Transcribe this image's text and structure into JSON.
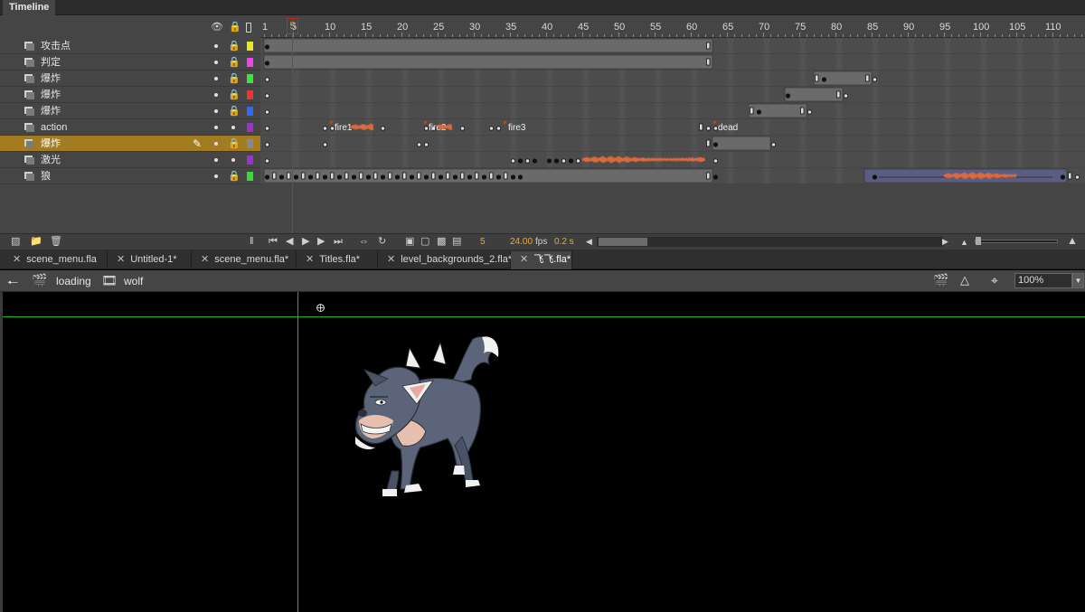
{
  "timeline": {
    "tab_label": "Timeline",
    "ruler_labels": [
      "1",
      "5",
      "10",
      "15",
      "20",
      "25",
      "30",
      "35",
      "40",
      "45",
      "50",
      "55",
      "60",
      "65",
      "70",
      "75",
      "80",
      "85",
      "90",
      "95",
      "100",
      "105",
      "110"
    ],
    "current_frame_badge": "5",
    "layers": [
      {
        "name": "攻击点",
        "color": "#e8e81c"
      },
      {
        "name": "判定",
        "color": "#ee44ee"
      },
      {
        "name": "爆炸",
        "color": "#44dd44"
      },
      {
        "name": "爆炸",
        "color": "#ee3333"
      },
      {
        "name": "爆炸",
        "color": "#3366ff"
      },
      {
        "name": "action",
        "color": "#9933cc"
      },
      {
        "name": "爆炸",
        "color": "#888888",
        "selected": true
      },
      {
        "name": "激光",
        "color": "#9933cc"
      },
      {
        "name": "狼",
        "color": "#33dd33"
      }
    ],
    "frame_labels": {
      "fire1": "fire1",
      "fire2": "fire2",
      "fire3": "fire3",
      "dead": "dead"
    },
    "footer": {
      "current_frame": "5",
      "fps": "24.00",
      "fps_unit": "fps",
      "elapsed_time": "0.2 s"
    }
  },
  "doc_tabs": [
    {
      "label": "scene_menu.fla"
    },
    {
      "label": "Untitled-1*"
    },
    {
      "label": "scene_menu.fla*"
    },
    {
      "label": "Titles.fla*"
    },
    {
      "label": "level_backgrounds_2.fla*"
    },
    {
      "label": "飞飞.fla*",
      "active": true
    }
  ],
  "edit_bar": {
    "scene_label": "loading",
    "symbol_label": "wolf",
    "zoom": "100%"
  },
  "icons": {
    "eye": "eye-icon",
    "lock": "lock-icon",
    "outline": "outline-icon",
    "back": "back-arrow-icon",
    "scene": "clapper-icon",
    "symbol": "movieclip-icon"
  },
  "colors": {
    "playhead": "#c02a20",
    "selected_layer": "#a37b21",
    "guide": "#17b617",
    "accent_text": "#f2a43a"
  }
}
